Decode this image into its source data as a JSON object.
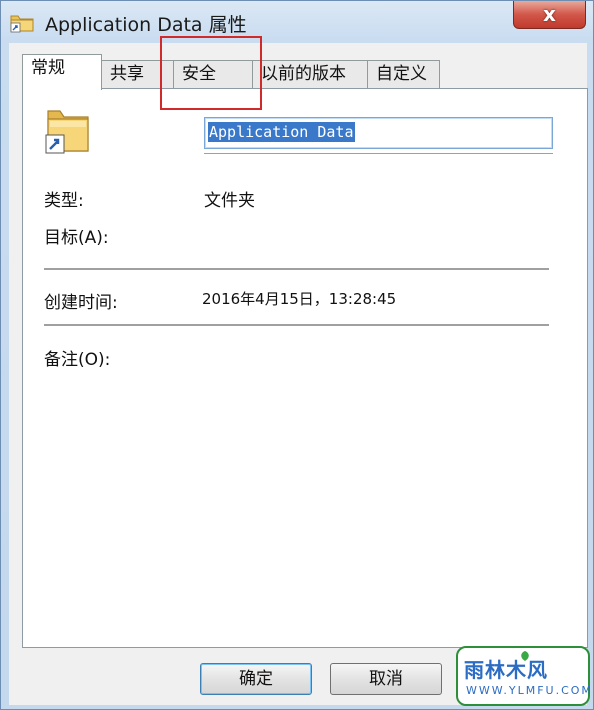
{
  "window": {
    "title": "Application Data 属性",
    "close_label": "x"
  },
  "tabs": [
    {
      "label": "常规",
      "active": true
    },
    {
      "label": "共享",
      "active": false
    },
    {
      "label": "安全",
      "active": false
    },
    {
      "label": "以前的版本",
      "active": false
    },
    {
      "label": "自定义",
      "active": false
    }
  ],
  "general": {
    "name_value": "Application Data",
    "type_label": "类型:",
    "type_value": "文件夹",
    "target_label": "目标(A):",
    "created_label": "创建时间:",
    "created_value": "2016年4月15日，13:28:45",
    "comment_label": "备注(O):"
  },
  "buttons": {
    "ok": "确定",
    "cancel": "取消"
  },
  "watermark": {
    "logo_text": "雨林木风",
    "url": "WWW.YLMFU.COM"
  },
  "colors": {
    "highlight_box": "#d12a2a",
    "selection": "#3a78c9",
    "close_button": "#c8453a"
  },
  "icons": [
    "folder-shortcut-icon",
    "close-icon"
  ]
}
